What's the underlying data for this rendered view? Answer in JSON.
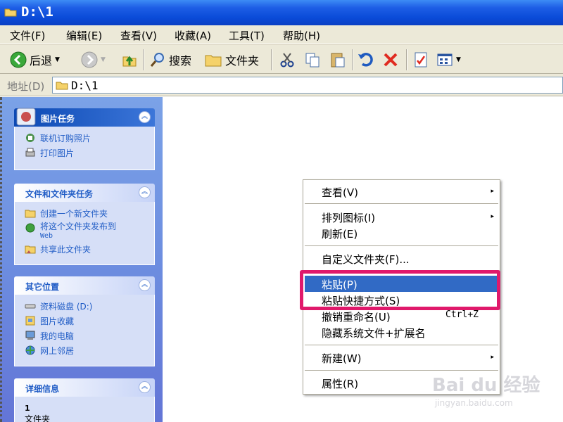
{
  "window": {
    "title": "D:\\1"
  },
  "menu": [
    {
      "label": "文件(F)"
    },
    {
      "label": "编辑(E)"
    },
    {
      "label": "查看(V)"
    },
    {
      "label": "收藏(A)"
    },
    {
      "label": "工具(T)"
    },
    {
      "label": "帮助(H)"
    }
  ],
  "toolbar": {
    "back_label": "后退",
    "search_label": "搜索",
    "folders_label": "文件夹",
    "icons": [
      "back-icon",
      "forward-icon",
      "up-icon",
      "search-icon",
      "folders-icon",
      "cut-icon",
      "copy-icon",
      "paste-icon",
      "undo-icon",
      "delete-icon",
      "properties-icon",
      "views-icon"
    ]
  },
  "address": {
    "label": "地址(D)",
    "value": "D:\\1"
  },
  "panels": {
    "picture_tasks": {
      "title": "图片任务",
      "items": [
        {
          "label": "联机订购照片",
          "icon": "order-photos-icon"
        },
        {
          "label": "打印图片",
          "icon": "print-icon"
        }
      ]
    },
    "file_tasks": {
      "title": "文件和文件夹任务",
      "items": [
        {
          "label": "创建一个新文件夹",
          "icon": "new-folder-icon"
        },
        {
          "label": "将这个文件夹发布到",
          "sub": "Web",
          "icon": "publish-web-icon"
        },
        {
          "label": "共享此文件夹",
          "icon": "share-folder-icon"
        }
      ]
    },
    "other_places": {
      "title": "其它位置",
      "items": [
        {
          "label": "资料磁盘 (D:)",
          "icon": "drive-icon"
        },
        {
          "label": "图片收藏",
          "icon": "my-pictures-icon"
        },
        {
          "label": "我的电脑",
          "icon": "my-computer-icon"
        },
        {
          "label": "网上邻居",
          "icon": "network-icon"
        }
      ]
    },
    "details": {
      "title": "详细信息",
      "line1": "1",
      "line2": "文件夹"
    }
  },
  "context_menu": {
    "items": [
      {
        "label": "查看(V)",
        "submenu": true
      },
      {
        "label": "排列图标(I)",
        "submenu": true
      },
      {
        "label": "刷新(E)"
      },
      {
        "label": "自定义文件夹(F)..."
      },
      {
        "label": "粘贴(P)",
        "selected": true
      },
      {
        "label": "粘贴快捷方式(S)"
      },
      {
        "label": "撤销重命名(U)",
        "shortcut": "Ctrl+Z"
      },
      {
        "label": "隐藏系统文件+扩展名"
      },
      {
        "label": "新建(W)",
        "submenu": true
      },
      {
        "label": "属性(R)"
      }
    ],
    "arrow": "▸",
    "highlight_color": "#e0196b"
  },
  "watermark": {
    "line1": "Bai du 经验",
    "line2": "jingyan.baidu.com"
  },
  "colors": {
    "selection": "#316ac5",
    "title_bar": "#0a4bd8",
    "task_pane": "#6d8ee0"
  }
}
